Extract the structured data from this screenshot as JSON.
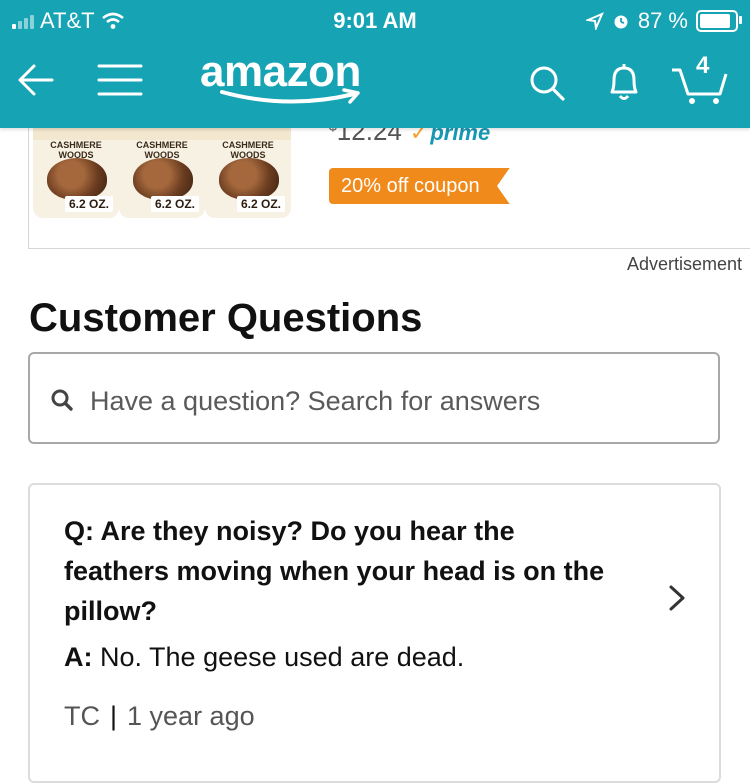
{
  "status_bar": {
    "carrier": "AT&T",
    "time": "9:01 AM",
    "battery_percent": "87 %",
    "battery_level": 0.87
  },
  "header": {
    "logo_text": "amazon",
    "cart_count": "4",
    "icons": [
      "back-arrow-icon",
      "menu-icon",
      "search-icon",
      "bell-icon",
      "cart-icon"
    ],
    "bar_color": "#16a3b4"
  },
  "ad": {
    "product_label": "CASHMERE WOODS",
    "size_label": "6.2 OZ.",
    "price": "12.24",
    "price_symbol": "$",
    "prime_label": "prime",
    "coupon": "20% off coupon",
    "advertisement_label": "Advertisement",
    "coupon_color": "#f08a1a"
  },
  "customer_questions": {
    "title": "Customer Questions",
    "search_placeholder": "Have a question? Search for answers",
    "items": [
      {
        "question_prefix": "Q:",
        "question": "Are they noisy? Do you hear the feathers moving when your head is on the pillow?",
        "answer_prefix": "A:",
        "answer": "No. The geese used are dead.",
        "author": "TC",
        "separator": "|",
        "time_ago": "1 year ago"
      }
    ]
  }
}
